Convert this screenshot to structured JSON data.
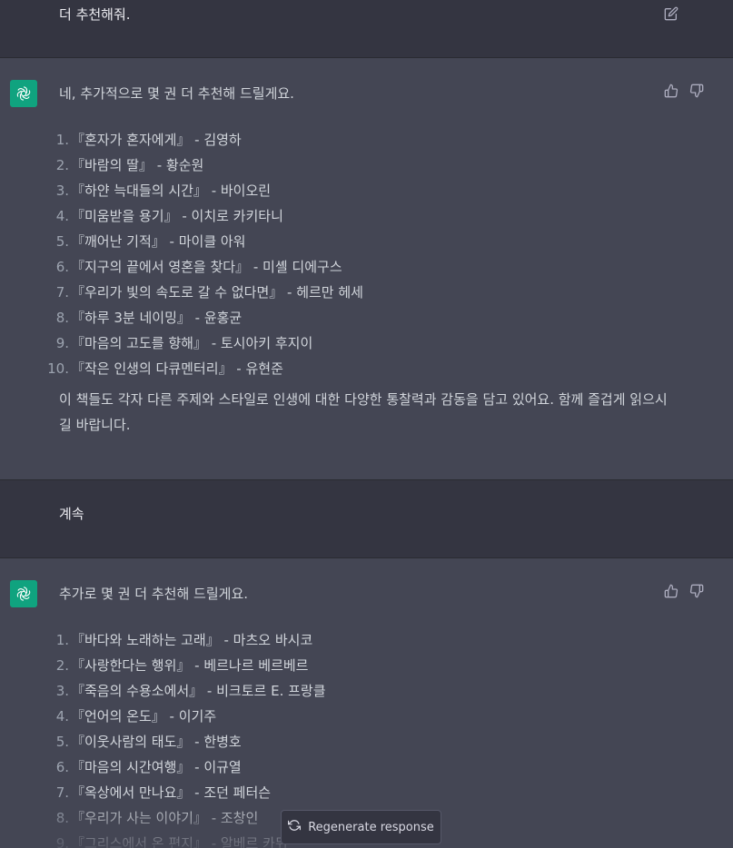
{
  "messages": {
    "user1": {
      "text": "더 추천해줘."
    },
    "assistant1": {
      "intro": "네, 추가적으로 몇 권 더 추천해 드릴게요.",
      "items": [
        {
          "num": "1.",
          "text": "『혼자가 혼자에게』 - 김영하"
        },
        {
          "num": "2.",
          "text": "『바람의 딸』 - 황순원"
        },
        {
          "num": "3.",
          "text": "『하얀 늑대들의 시간』 - 바이오린"
        },
        {
          "num": "4.",
          "text": "『미움받을 용기』 - 이치로 카키타니"
        },
        {
          "num": "5.",
          "text": "『깨어난 기적』 - 마이클 아워"
        },
        {
          "num": "6.",
          "text": "『지구의 끝에서 영혼을 찾다』 - 미셸 디에구스"
        },
        {
          "num": "7.",
          "text": "『우리가 빛의 속도로 갈 수 없다면』 - 헤르만 헤세"
        },
        {
          "num": "8.",
          "text": "『하루 3분 네이밍』 - 윤홍균"
        },
        {
          "num": "9.",
          "text": "『마음의 고도를 향해』 - 토시아키 후지이"
        },
        {
          "num": "10.",
          "text": "『작은 인생의 다큐멘터리』 - 유현준"
        }
      ],
      "outro": "이 책들도 각자 다른 주제와 스타일로 인생에 대한 다양한 통찰력과 감동을 담고 있어요. 함께 즐겁게 읽으시길 바랍니다."
    },
    "user2": {
      "text": "계속"
    },
    "assistant2": {
      "intro": "추가로 몇 권 더 추천해 드릴게요.",
      "items": [
        {
          "num": "1.",
          "text": "『바다와 노래하는 고래』 - 마츠오 바시코"
        },
        {
          "num": "2.",
          "text": "『사랑한다는 행위』 - 베르나르 베르베르"
        },
        {
          "num": "3.",
          "text": "『죽음의 수용소에서』 - 비크토르 E. 프랑클"
        },
        {
          "num": "4.",
          "text": "『언어의 온도』 - 이기주"
        },
        {
          "num": "5.",
          "text": "『이웃사람의 태도』 - 한병호"
        },
        {
          "num": "6.",
          "text": "『마음의 시간여행』 - 이규열"
        },
        {
          "num": "7.",
          "text": "『옥상에서 만나요』 - 조던 페터슨"
        },
        {
          "num": "8.",
          "text": "『우리가 사는 이야기』 - 조창인"
        },
        {
          "num": "9.",
          "text": "『그리스에서 온 편지』 - 알베르 카뮈"
        }
      ]
    }
  },
  "regenerate_label": "Regenerate response",
  "colors": {
    "user_bg": "#343541",
    "assistant_bg": "#444654",
    "avatar": "#10a37f"
  },
  "icons": [
    "edit-icon",
    "openai-logo-icon",
    "thumbs-up-icon",
    "thumbs-down-icon",
    "refresh-icon"
  ]
}
